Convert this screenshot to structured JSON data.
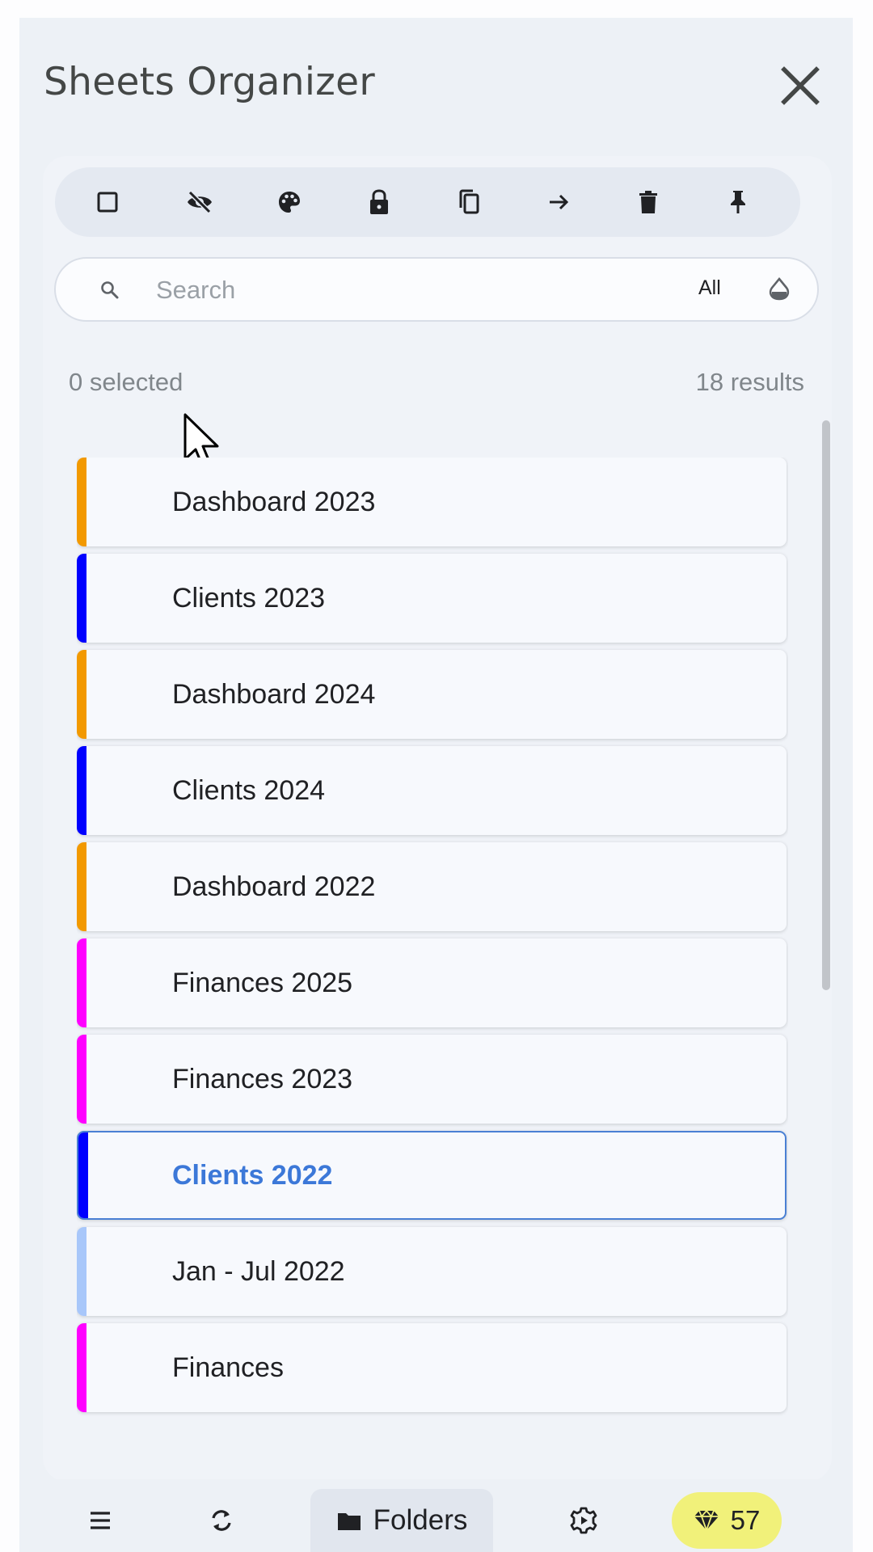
{
  "header": {
    "title": "Sheets Organizer"
  },
  "toolbar": {
    "tools": [
      "select-all-icon",
      "hide-icon",
      "palette-icon",
      "lock-icon",
      "copy-icon",
      "arrow-right-icon",
      "trash-icon",
      "pin-icon"
    ]
  },
  "search": {
    "placeholder": "Search",
    "value": "",
    "filter_label": "All"
  },
  "status": {
    "selected": "0 selected",
    "results": "18 results"
  },
  "sheets": [
    {
      "name": "Dashboard 2023",
      "color": "#f29900"
    },
    {
      "name": "Clients 2023",
      "color": "#0000ff"
    },
    {
      "name": "Dashboard 2024",
      "color": "#f29900"
    },
    {
      "name": "Clients 2024",
      "color": "#0000ff"
    },
    {
      "name": "Dashboard 2022",
      "color": "#f29900"
    },
    {
      "name": "Finances 2025",
      "color": "#ff00ff"
    },
    {
      "name": "Finances 2023",
      "color": "#ff00ff"
    },
    {
      "name": "Clients 2022",
      "color": "#0000ff",
      "active": true
    },
    {
      "name": "Jan - Jul 2022",
      "color": "#a8c7fa"
    },
    {
      "name": "Finances",
      "color": "#ff00ff"
    }
  ],
  "bottom_nav": {
    "folders_label": "Folders",
    "credits": "57"
  },
  "colors": {
    "accent": "#3c78d8",
    "credits_bg": "#f1f17a"
  }
}
